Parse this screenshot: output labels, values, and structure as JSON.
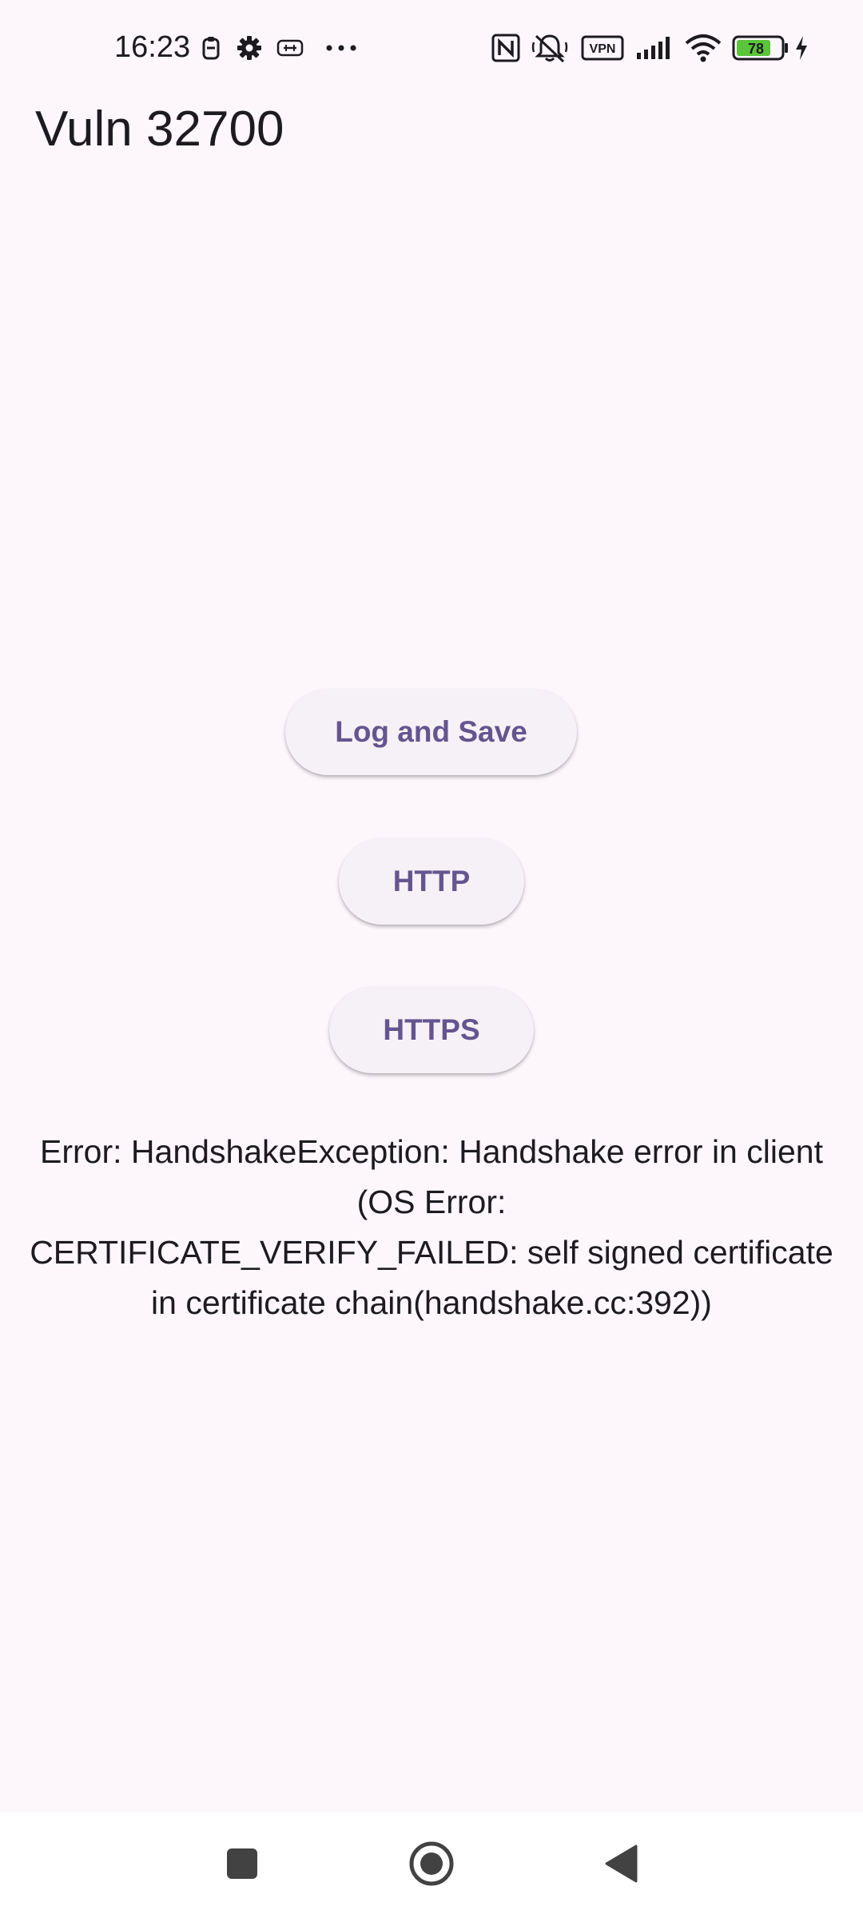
{
  "status_bar": {
    "time": "16:23",
    "battery_level": "78",
    "vpn_label": "VPN",
    "icons": [
      "clipboard-icon",
      "gear-icon",
      "screen-record-icon",
      "more-dots-icon",
      "nfc-icon",
      "vibrate-mute-icon",
      "vpn-icon",
      "signal-icon",
      "wifi-icon",
      "battery-icon",
      "charging-icon"
    ],
    "battery_color": "#5ac43a"
  },
  "app_bar": {
    "title": "Vuln 32700"
  },
  "buttons": {
    "log_and_save": "Log and Save",
    "http": "HTTP",
    "https": "HTTPS"
  },
  "error": {
    "line1": "Error: HandshakeException: Handshake error in client",
    "line2": "(OS Error:",
    "line3": "CERTIFICATE_VERIFY_FAILED: self signed certificate",
    "line4": "in certificate chain(handshake.cc:392))"
  },
  "nav_bar": {
    "icons": [
      "recents-square-icon",
      "home-circle-icon",
      "back-triangle-icon"
    ]
  },
  "colors": {
    "background": "#fdf7fc",
    "button_background": "#f6f1f7",
    "button_text": "#65558f",
    "text": "#1d1b20"
  }
}
